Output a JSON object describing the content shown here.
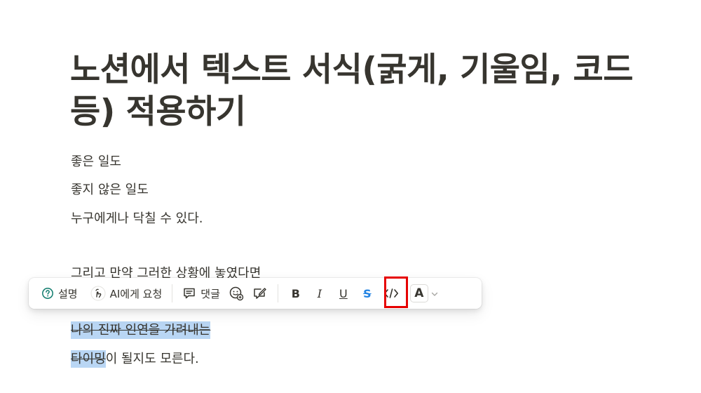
{
  "page": {
    "title": "노션에서 텍스트 서식(굵게, 기울임, 코드 등) 적용하기",
    "lines": [
      "좋은 일도",
      "좋지 않은 일도",
      "누구에게나 닥칠 수 있다.",
      "그리고 만약 그러한 상황에 놓였다면"
    ],
    "selected_line": "나의 진짜 인연을 가려내는",
    "last_line_selected": "타이밍",
    "last_line_rest": "이 될지도 모른다."
  },
  "toolbar": {
    "explain_label": "설명",
    "ask_ai_label": "AI에게 요청",
    "comment_label": "댓글",
    "bold_label": "B",
    "italic_label": "I",
    "underline_label": "U",
    "strike_label": "S",
    "color_label": "A",
    "icons": {
      "explain": "question-circle-icon",
      "ask_ai": "ai-hand-icon",
      "comment": "comment-icon",
      "emoji": "emoji-add-icon",
      "edit": "edit-note-icon",
      "code": "code-icon",
      "chevron": "chevron-down-icon"
    }
  },
  "colors": {
    "text": "#37352f",
    "selection": "#b9d6f4",
    "active": "#2383e2",
    "highlight_box": "#e60000",
    "explain_icon": "#0f7b6c"
  }
}
